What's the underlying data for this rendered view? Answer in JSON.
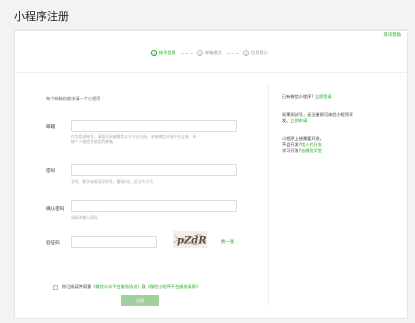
{
  "header": {
    "title": "小程序注册"
  },
  "top_link": "资讯帮助",
  "steps": [
    {
      "num": "1",
      "label": "帐号信息"
    },
    {
      "num": "2",
      "label": "邮箱激活"
    },
    {
      "num": "3",
      "label": "信息登记"
    }
  ],
  "form": {
    "intro": "每个邮箱仅能申请一个小程序",
    "email": {
      "label": "邮箱",
      "placeholder": "",
      "help": [
        "作为登录帐号，请填写未被微信公众平台注册，未被微信开放平台注册，未",
        "被个人微信号绑定的邮箱"
      ]
    },
    "password": {
      "label": "密码",
      "placeholder": "",
      "help": [
        "字母、数字或者英文符号，最短8位，区分大小写"
      ]
    },
    "confirm": {
      "label": "确认密码",
      "placeholder": "",
      "help": [
        "请再次输入密码"
      ]
    },
    "captcha": {
      "label": "验证码",
      "placeholder": "",
      "image_text": "pZdR",
      "refresh": "换一张"
    },
    "agree": {
      "prefix": "你已阅读并同意",
      "link1": "《微信公众平台服务协议》",
      "mid": "及",
      "link2": "《微信小程序平台服务条款》"
    },
    "submit": "注册"
  },
  "sidebar": {
    "q1": "已有微信小程序?",
    "q1_link": "立即登录",
    "q2a": "如果测试号，无注册即可体验小程序开",
    "q2b": "发。",
    "q2_link": "立即申请",
    "q3": "小程序上线需要开发。",
    "q4": "不会开发?",
    "q4_link": "找人代开发",
    "q5": "学习开发?",
    "q5_link": "去微信学堂"
  },
  "colors": {
    "accent": "#1aad19",
    "submit_bg": "#9fd09d"
  }
}
